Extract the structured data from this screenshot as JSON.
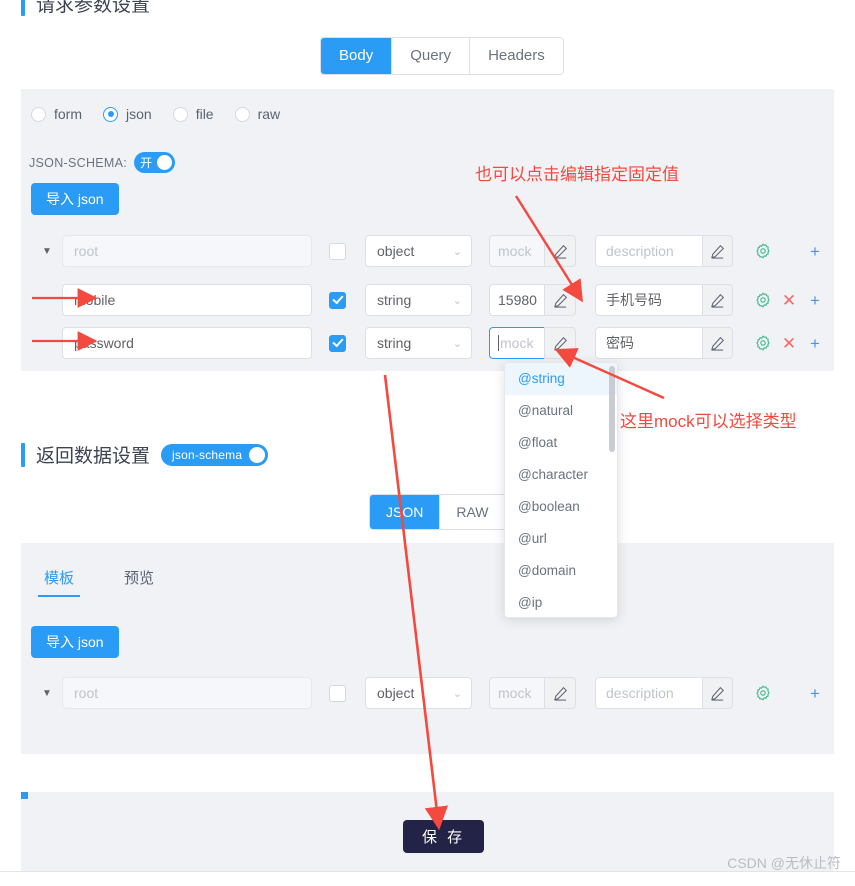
{
  "request_section": {
    "title": "请求参数设置",
    "tabs": [
      {
        "label": "Body",
        "active": true
      },
      {
        "label": "Query",
        "active": false
      },
      {
        "label": "Headers",
        "active": false
      }
    ],
    "body_type_radios": [
      {
        "label": "form",
        "checked": false
      },
      {
        "label": "json",
        "checked": true
      },
      {
        "label": "file",
        "checked": false
      },
      {
        "label": "raw",
        "checked": false
      }
    ],
    "json_schema": {
      "caption": "JSON-SCHEMA:",
      "toggle_label": "开",
      "on": true
    },
    "import_button": "导入 json",
    "rows": [
      {
        "name": "root",
        "name_is_placeholder": true,
        "required": false,
        "type": "object",
        "mock": "mock",
        "mock_is_placeholder": true,
        "mock_focused": false,
        "description": "description",
        "description_is_placeholder": true,
        "has_delete": false
      },
      {
        "name": "mobile",
        "name_is_placeholder": false,
        "required": true,
        "type": "string",
        "mock": "15980",
        "mock_is_placeholder": false,
        "mock_focused": false,
        "description": "手机号码",
        "description_is_placeholder": false,
        "has_delete": true
      },
      {
        "name": "password",
        "name_is_placeholder": false,
        "required": true,
        "type": "string",
        "mock": "mock",
        "mock_is_placeholder": true,
        "mock_focused": true,
        "description": "密码",
        "description_is_placeholder": false,
        "has_delete": true
      }
    ]
  },
  "mock_dropdown": {
    "options": [
      "@string",
      "@natural",
      "@float",
      "@character",
      "@boolean",
      "@url",
      "@domain",
      "@ip"
    ],
    "highlighted": "@string"
  },
  "response_section": {
    "title": "返回数据设置",
    "schema_pill_label": "json-schema",
    "format_tabs": [
      {
        "label": "JSON",
        "active": true
      },
      {
        "label": "RAW",
        "active": false
      }
    ],
    "sub_tabs": [
      {
        "label": "模板",
        "active": true
      },
      {
        "label": "预览",
        "active": false
      }
    ],
    "import_button": "导入 json",
    "rows": [
      {
        "name": "root",
        "name_is_placeholder": true,
        "required": false,
        "type": "object",
        "mock": "mock",
        "mock_is_placeholder": true,
        "mock_focused": false,
        "description": "description",
        "description_is_placeholder": true,
        "has_delete": false
      }
    ]
  },
  "footer": {
    "save_label": "保 存",
    "watermark": "CSDN @无休止符"
  },
  "annotations": [
    {
      "text": "也可以点击编辑指定固定值"
    },
    {
      "text": "这里mock可以选择类型"
    }
  ],
  "colors": {
    "accent": "#2b9cf5",
    "panel_bg": "#f0f2f5",
    "annotation_red": "#f4493f",
    "save_bg": "#232347",
    "gear_green": "#3fb98a",
    "delete_red": "#f26a6a",
    "add_blue": "#4f93e8"
  },
  "icons": {
    "caret": "▼",
    "chevron_down": "⌄",
    "pencil": "pencil-icon",
    "gear": "gear-icon",
    "delete": "✕",
    "add": "+"
  }
}
